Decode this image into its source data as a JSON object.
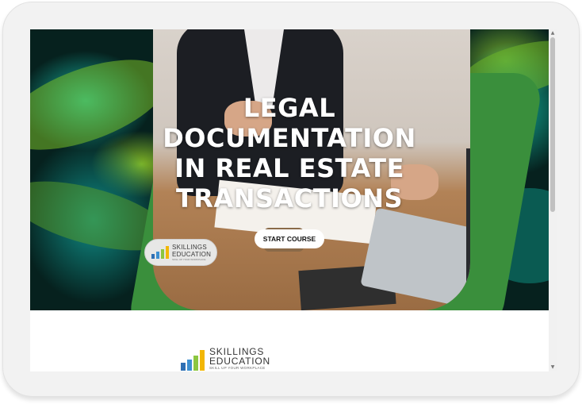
{
  "hero": {
    "title_lines": [
      "LEGAL",
      "DOCUMENTATION",
      "IN REAL ESTATE",
      "TRANSACTIONS"
    ],
    "start_button_label": "START COURSE"
  },
  "badge_logo": {
    "name": "SKILLINGS EDUCATION",
    "tagline": "SKILL UP YOUR WORKPLACE"
  },
  "footer_logo": {
    "line1": "SKILLINGS",
    "line2": "EDUCATION",
    "tagline": "SKILL UP YOUR WORKPLACE"
  },
  "colors": {
    "brand_green": "#3a8f3c",
    "logo_bar_1": "#2f6fb3",
    "logo_bar_2": "#3d8fd0",
    "logo_bar_3": "#8cc63f",
    "logo_bar_4": "#f2b705"
  },
  "icons": {
    "scroll_up": "chevron-up-icon",
    "scroll_down": "chevron-down-icon"
  }
}
